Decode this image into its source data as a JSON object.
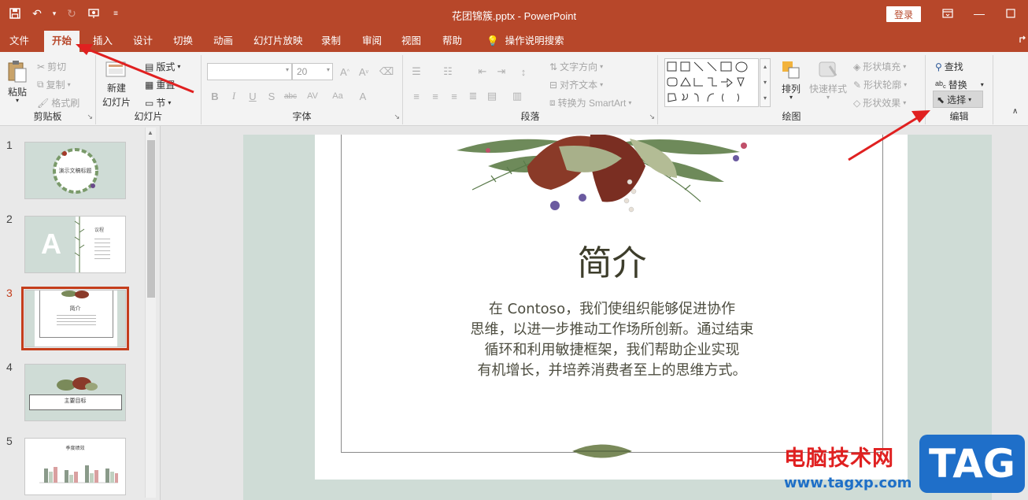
{
  "window": {
    "title": "花团锦簇.pptx  -  PowerPoint",
    "login_label": "登录"
  },
  "tabs": [
    "文件",
    "开始",
    "插入",
    "设计",
    "切换",
    "动画",
    "幻灯片放映",
    "录制",
    "审阅",
    "视图",
    "帮助"
  ],
  "tell_me": "操作说明搜索",
  "ribbon": {
    "clipboard": {
      "paste": "粘贴",
      "cut": "剪切",
      "copy": "复制",
      "format_painter": "格式刷",
      "label": "剪贴板"
    },
    "slides": {
      "new_slide_line1": "新建",
      "new_slide_line2": "幻灯片",
      "layout": "版式",
      "reset": "重置",
      "section": "节",
      "label": "幻灯片"
    },
    "font": {
      "font_size": "20",
      "label": "字体"
    },
    "paragraph": {
      "text_direction": "文字方向",
      "align_text": "对齐文本",
      "convert_smartart": "转换为 SmartArt",
      "label": "段落"
    },
    "drawing": {
      "arrange": "排列",
      "quick_styles": "快速样式",
      "shape_fill": "形状填充",
      "shape_outline": "形状轮廓",
      "shape_effects": "形状效果",
      "label": "绘图"
    },
    "editing": {
      "find": "查找",
      "replace": "替换",
      "select": "选择",
      "label": "编辑"
    }
  },
  "thumbnails": [
    {
      "number": "1",
      "title": "演示文稿标题"
    },
    {
      "number": "2",
      "title": "议程"
    },
    {
      "number": "3",
      "title": "简介"
    },
    {
      "number": "4",
      "title": "主要目标"
    },
    {
      "number": "5",
      "title": "季度绩效"
    }
  ],
  "slide": {
    "title": "简介",
    "body_lines": [
      "在 Contoso，我们使组织能够促进协作",
      "思维，以进一步推动工作场所创新。通过结束",
      "循环和利用敏捷框架，我们帮助企业实现",
      "有机增长，并培养消费者至上的思维方式。"
    ]
  },
  "watermark": {
    "text": "电脑技术网",
    "url": "www.tagxp.com",
    "logo": "TAG"
  },
  "colors": {
    "accent": "#b7472a",
    "selection": "#c43e1c",
    "annotation_arrow": "#e02020"
  }
}
